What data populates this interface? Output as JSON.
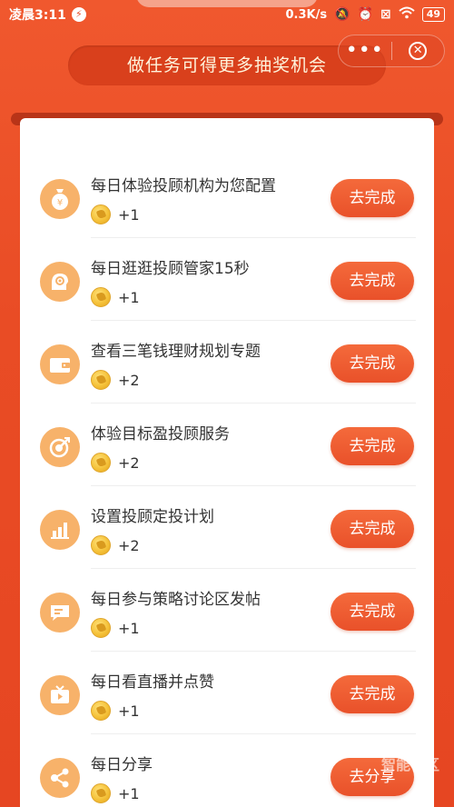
{
  "status_bar": {
    "time": "凌晨3:11",
    "network_speed": "0.3K/s",
    "battery": "49"
  },
  "header": {
    "banner_text": "做任务可得更多抽奖机会",
    "more_label": "•••",
    "close_icon": "close-circle-icon"
  },
  "tasks": [
    {
      "title": "每日体验投顾机构为您配置",
      "reward": "+1",
      "button": "去完成",
      "icon": "money-bag-icon"
    },
    {
      "title": "每日逛逛投顾管家15秒",
      "reward": "+1",
      "button": "去完成",
      "icon": "brain-gear-icon"
    },
    {
      "title": "查看三笔钱理财规划专题",
      "reward": "+2",
      "button": "去完成",
      "icon": "wallet-icon"
    },
    {
      "title": "体验目标盈投顾服务",
      "reward": "+2",
      "button": "去完成",
      "icon": "target-icon"
    },
    {
      "title": "设置投顾定投计划",
      "reward": "+2",
      "button": "去完成",
      "icon": "bar-chart-icon"
    },
    {
      "title": "每日参与策略讨论区发帖",
      "reward": "+1",
      "button": "去完成",
      "icon": "chat-icon"
    },
    {
      "title": "每日看直播并点赞",
      "reward": "+1",
      "button": "去完成",
      "icon": "tv-icon"
    },
    {
      "title": "每日分享",
      "reward": "+1",
      "button": "去分享",
      "icon": "share-icon"
    }
  ],
  "watermark": {
    "text": "智能社区"
  },
  "colors": {
    "background": "#e8502a",
    "button": "#ee5c30",
    "icon_circle": "#f7b26a",
    "coin": "#f5c23a"
  }
}
